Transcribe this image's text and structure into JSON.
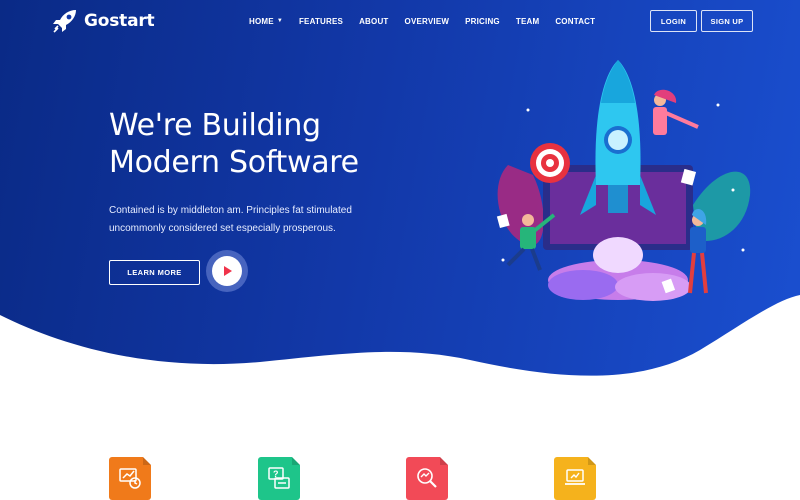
{
  "brand": {
    "name": "Gostart",
    "logo_icon": "rocket-icon"
  },
  "nav": {
    "items": [
      "HOME",
      "FEATURES",
      "ABOUT",
      "OVERVIEW",
      "PRICING",
      "TEAM",
      "CONTACT"
    ],
    "home_dropdown_icon": "chevron-down-icon"
  },
  "auth": {
    "login_label": "LOGIN",
    "signup_label": "SIGN UP"
  },
  "hero": {
    "title_line1": "We're Building",
    "title_line2": "Modern Software",
    "subtitle_line1": "Contained is by middleton am. Principles fat stimulated",
    "subtitle_line2": "uncommonly considered set especially prosperous.",
    "cta_label": "LEARN MORE",
    "play_icon": "play-icon",
    "illustration": "rocket-launch-illustration"
  },
  "features": [
    {
      "icon": "analytics-icon",
      "color": "#f07a1a"
    },
    {
      "icon": "help-chat-icon",
      "color": "#1ec58a"
    },
    {
      "icon": "search-analytics-icon",
      "color": "#f24a57"
    },
    {
      "icon": "growth-laptop-icon",
      "color": "#f5b21c"
    }
  ],
  "colors": {
    "hero_start": "#0a2a86",
    "hero_end": "#1a4fd0",
    "play_accent": "#f0334a"
  }
}
